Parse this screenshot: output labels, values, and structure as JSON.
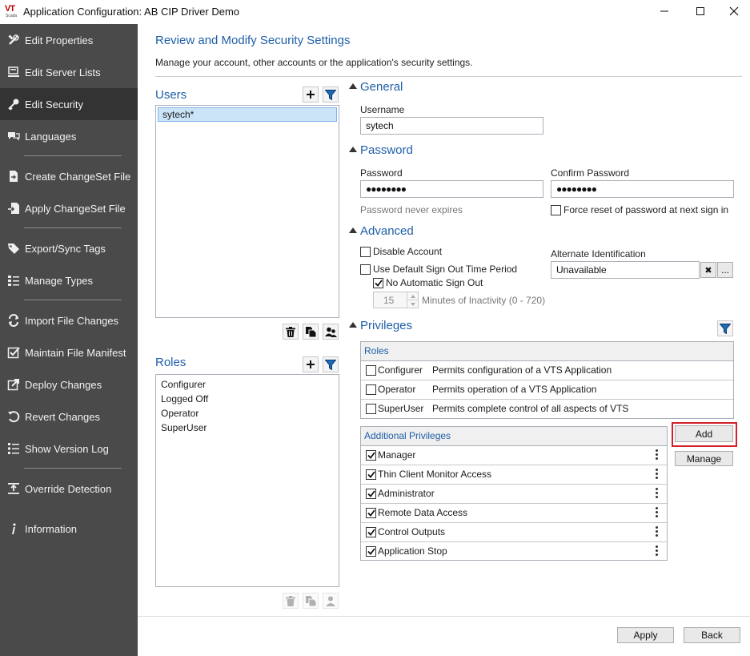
{
  "window": {
    "logo_text": "VT",
    "logo_sub": "Scada",
    "title": "Application Configuration: AB CIP Driver Demo",
    "minimize": "—",
    "maximize": "☐",
    "close": "✕"
  },
  "sidebar": {
    "items": [
      {
        "label": "Edit Properties",
        "icon": "wrench-icon"
      },
      {
        "label": "Edit Server Lists",
        "icon": "server-list-icon"
      },
      {
        "label": "Edit Security",
        "icon": "key-icon",
        "active": true
      },
      {
        "label": "Languages",
        "icon": "speech-bubbles-icon"
      },
      {
        "label": "Create ChangeSet File",
        "icon": "file-export-icon"
      },
      {
        "label": "Apply ChangeSet File",
        "icon": "file-import-icon"
      },
      {
        "label": "Export/Sync Tags",
        "icon": "tag-icon"
      },
      {
        "label": "Manage Types",
        "icon": "list-icon"
      },
      {
        "label": "Import File Changes",
        "icon": "sync-icon"
      },
      {
        "label": "Maintain File Manifest",
        "icon": "checkbox-icon"
      },
      {
        "label": "Deploy Changes",
        "icon": "deploy-icon"
      },
      {
        "label": "Revert Changes",
        "icon": "revert-icon"
      },
      {
        "label": "Show Version Log",
        "icon": "version-log-icon"
      },
      {
        "label": "Override Detection",
        "icon": "override-icon"
      },
      {
        "label": "Information",
        "icon": "info-icon"
      }
    ]
  },
  "header": {
    "title": "Review and Modify Security Settings",
    "subtitle": "Manage your account, other accounts or the application's security settings."
  },
  "users": {
    "title": "Users",
    "items": [
      "sytech*"
    ]
  },
  "roles_list": {
    "title": "Roles",
    "items": [
      "Configurer",
      "Logged Off",
      "Operator",
      "SuperUser"
    ]
  },
  "general": {
    "title": "General",
    "username_label": "Username",
    "username_value": "sytech"
  },
  "password": {
    "title": "Password",
    "password_label": "Password",
    "password_value": "●●●●●●●●",
    "confirm_label": "Confirm Password",
    "confirm_value": "●●●●●●●●",
    "never_expires": "Password never expires",
    "force_reset_label": "Force reset of password at next sign in"
  },
  "advanced": {
    "title": "Advanced",
    "disable_account_label": "Disable Account",
    "default_signout_label": "Use Default Sign Out Time Period",
    "no_auto_signout_label": "No Automatic Sign Out",
    "minutes_value": "15",
    "minutes_label": "Minutes of Inactivity (0 - 720)",
    "alt_id_label": "Alternate Identification",
    "alt_id_value": "Unavailable",
    "clear_btn": "✖",
    "browse_btn": "..."
  },
  "privileges": {
    "title": "Privileges",
    "roles_header": "Roles",
    "roles": [
      {
        "name": "Configurer",
        "desc": "Permits configuration of a VTS Application",
        "checked": false
      },
      {
        "name": "Operator",
        "desc": "Permits operation of a VTS Application",
        "checked": false
      },
      {
        "name": "SuperUser",
        "desc": "Permits complete control of all aspects of VTS",
        "checked": false
      }
    ],
    "additional_header": "Additional Privileges",
    "additional": [
      {
        "name": "Manager",
        "checked": true
      },
      {
        "name": "Thin Client Monitor Access",
        "checked": true
      },
      {
        "name": "Administrator",
        "checked": true
      },
      {
        "name": "Remote Data Access",
        "checked": true
      },
      {
        "name": "Control Outputs",
        "checked": true
      },
      {
        "name": "Application Stop",
        "checked": true
      }
    ],
    "add_label": "Add",
    "manage_label": "Manage"
  },
  "footer": {
    "apply_label": "Apply",
    "back_label": "Back"
  },
  "colors": {
    "accent": "#1f5fa8",
    "sidebar_bg": "#4a4a4a",
    "sidebar_active": "#333333",
    "highlight_border": "#d4202a"
  }
}
